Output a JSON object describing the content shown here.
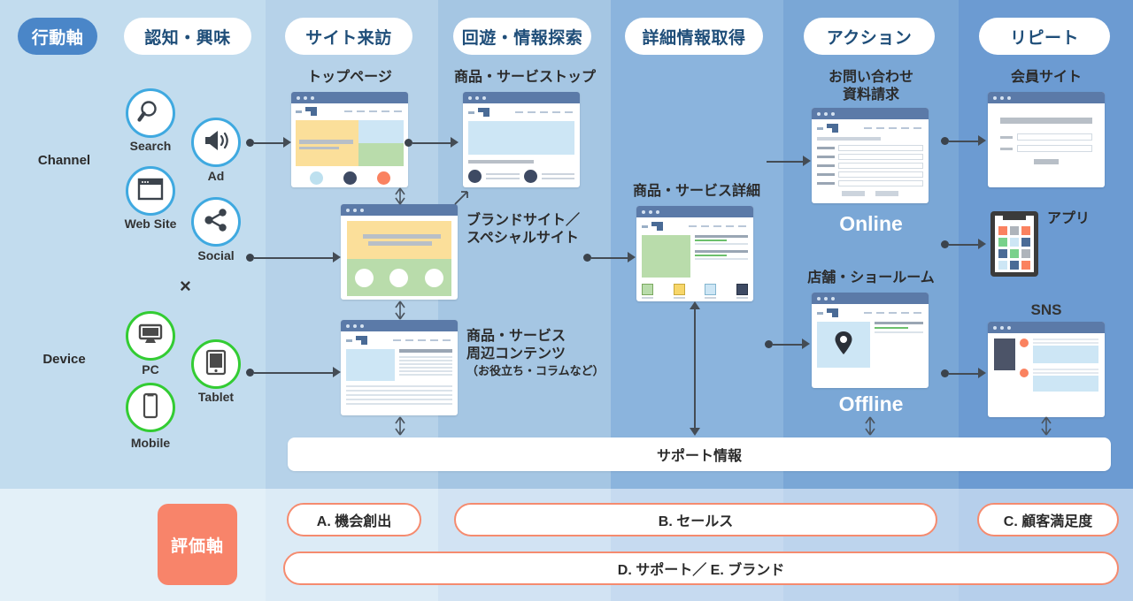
{
  "header": {
    "axis_label": "行動軸",
    "stages": [
      {
        "label": "認知・興味"
      },
      {
        "label": "サイト来訪"
      },
      {
        "label": "回遊・情報探索"
      },
      {
        "label": "詳細情報取得"
      },
      {
        "label": "アクション"
      },
      {
        "label": "リピート"
      }
    ]
  },
  "row_labels": {
    "channel": "Channel",
    "device": "Device",
    "cross": "×"
  },
  "channel_icons": [
    {
      "name": "Search",
      "icon": "search-icon"
    },
    {
      "name": "Ad",
      "icon": "megaphone-icon"
    },
    {
      "name": "Web Site",
      "icon": "browser-icon"
    },
    {
      "name": "Social",
      "icon": "share-icon"
    }
  ],
  "device_icons": [
    {
      "name": "PC",
      "icon": "desktop-icon"
    },
    {
      "name": "Tablet",
      "icon": "tablet-icon"
    },
    {
      "name": "Mobile",
      "icon": "mobile-icon"
    }
  ],
  "nodes": {
    "top_page": "トップページ",
    "product_top": "商品・サービストップ",
    "brand_site": "ブランドサイト／\nスペシャルサイト",
    "around_content_l1": "商品・サービス",
    "around_content_l2": "周辺コンテンツ",
    "around_content_note": "（お役立ち・コラムなど）",
    "product_detail": "商品・サービス詳細",
    "contact_l1": "お問い合わせ",
    "contact_l2": "資料請求",
    "online": "Online",
    "store_showroom": "店舗・ショールーム",
    "offline": "Offline",
    "member_site": "会員サイト",
    "app": "アプリ",
    "sns": "SNS",
    "support": "サポート情報"
  },
  "evaluation": {
    "axis_label": "評価軸",
    "items": [
      {
        "label": "A. 機会創出"
      },
      {
        "label": "B. セールス"
      },
      {
        "label": "C. 顧客満足度"
      },
      {
        "label": "D. サポート／ E. ブランド"
      }
    ]
  },
  "colors": {
    "axis_pill": "#4a86c8",
    "pill_text": "#1f4e79",
    "eval_accent": "#f8846a",
    "channel_ring": "#3fa9e0",
    "device_ring": "#33cc33",
    "connector": "#444c55"
  }
}
